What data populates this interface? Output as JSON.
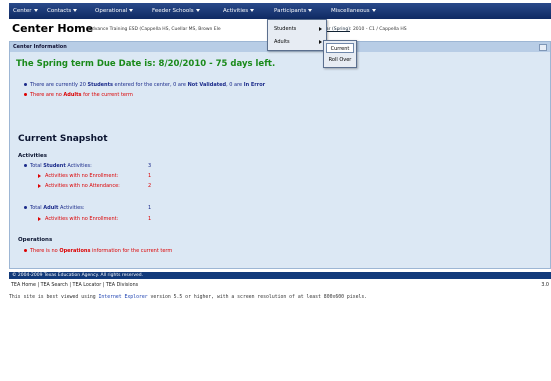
{
  "menu": [
    "Center",
    "Contacts",
    "Operational",
    "Feeder Schools",
    "Activities",
    "Participants",
    "Miscellaneous"
  ],
  "header": {
    "title": "Center Home",
    "subtitle": "Edvance Training ESD (Cappella HS, Cuellar MS, Brown Ele",
    "right_prefix": "Year (Spring)",
    "right_suffix": ": 2010 - C1 / Cappella HS"
  },
  "panel": {
    "title": "Center Information",
    "due_date": "The Spring term Due Date is: 8/20/2010 - 75 days left.",
    "students_line": {
      "pre": "There are currently 20 ",
      "bold1": "Students",
      "mid": " entered for the center, 0 are ",
      "bold2": "Not Validated",
      "mid2": ", 0 are ",
      "bold3": "In Error"
    },
    "adults_line": {
      "pre": "There are no ",
      "bold": "Adults",
      "post": " for the current term"
    },
    "snapshot": "Current Snapshot",
    "activities_heading": "Activities",
    "total_student_activities": {
      "pre": "Total ",
      "bold": "Student",
      "post": " Activities:",
      "value": "3"
    },
    "no_enrollment": {
      "label": "Activities with no Enrollment:",
      "value": "1"
    },
    "no_attendance": {
      "label": "Activities with no Attendance:",
      "value": "2"
    },
    "total_adult_activities": {
      "pre": "Total ",
      "bold": "Adult",
      "post": " Activities:",
      "value": "1"
    },
    "adult_no_enrollment": {
      "label": "Activities with no Enrollment:",
      "value": "1"
    },
    "operations_heading": "Operations",
    "operations_line": {
      "pre": "There is no ",
      "bold": "Operations",
      "post": " information for the current term"
    }
  },
  "footer": {
    "copyright": "© 2004-2009 Texas Education Agency. All rights reserved.",
    "links": "TEA Home | TEA Search | TEA Locator | TEA Divisions",
    "version": "3.0",
    "note_pre": "This site is best viewed using ",
    "note_link": "Internet Explorer",
    "note_post": " version 5.5 or higher, with a screen resolution of at least 800x600 pixels."
  },
  "dropdown": {
    "items": [
      "Students",
      "Adults"
    ],
    "submenu": [
      "Current",
      "Roll Over"
    ]
  },
  "colors": {
    "menubar": "#1a3a78",
    "panel": "#dce8f4",
    "due_green": "#1a8a1a",
    "alert_red": "#dd0000"
  }
}
